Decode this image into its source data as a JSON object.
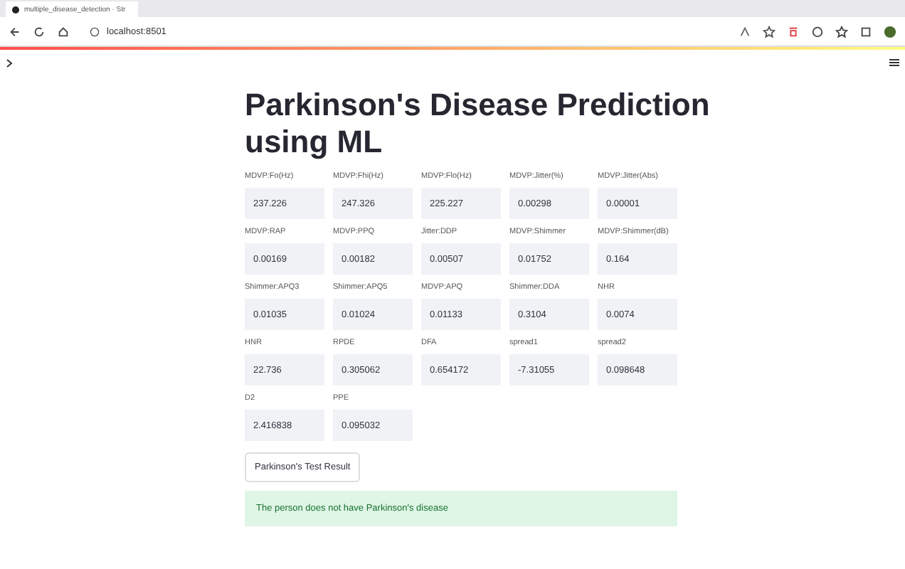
{
  "browser": {
    "tab_title": "multiple_disease_detection · Str",
    "url": "localhost:8501"
  },
  "page": {
    "title": "Parkinson's Disease Prediction using ML",
    "fields": [
      {
        "label": "MDVP:Fo(Hz)",
        "value": "237.226"
      },
      {
        "label": "MDVP:Fhi(Hz)",
        "value": "247.326"
      },
      {
        "label": "MDVP:Flo(Hz)",
        "value": "225.227"
      },
      {
        "label": "MDVP:Jitter(%)",
        "value": "0.00298"
      },
      {
        "label": "MDVP:Jitter(Abs)",
        "value": "0.00001"
      },
      {
        "label": "MDVP:RAP",
        "value": "0.00169"
      },
      {
        "label": "MDVP:PPQ",
        "value": "0.00182"
      },
      {
        "label": "Jitter:DDP",
        "value": "0.00507"
      },
      {
        "label": "MDVP:Shimmer",
        "value": "0.01752"
      },
      {
        "label": "MDVP:Shimmer(dB)",
        "value": "0.164"
      },
      {
        "label": "Shimmer:APQ3",
        "value": "0.01035"
      },
      {
        "label": "Shimmer:APQ5",
        "value": "0.01024"
      },
      {
        "label": "MDVP:APQ",
        "value": "0.01133"
      },
      {
        "label": "Shimmer:DDA",
        "value": "0.3104"
      },
      {
        "label": "NHR",
        "value": "0.0074"
      },
      {
        "label": "HNR",
        "value": "22.736"
      },
      {
        "label": "RPDE",
        "value": "0.305062"
      },
      {
        "label": "DFA",
        "value": "0.654172"
      },
      {
        "label": "spread1",
        "value": "-7.31055"
      },
      {
        "label": "spread2",
        "value": "0.098648"
      },
      {
        "label": "D2",
        "value": "2.416838"
      },
      {
        "label": "PPE",
        "value": "0.095032"
      }
    ],
    "button": "Parkinson's Test Result",
    "result": "The person does not have Parkinson's disease"
  }
}
